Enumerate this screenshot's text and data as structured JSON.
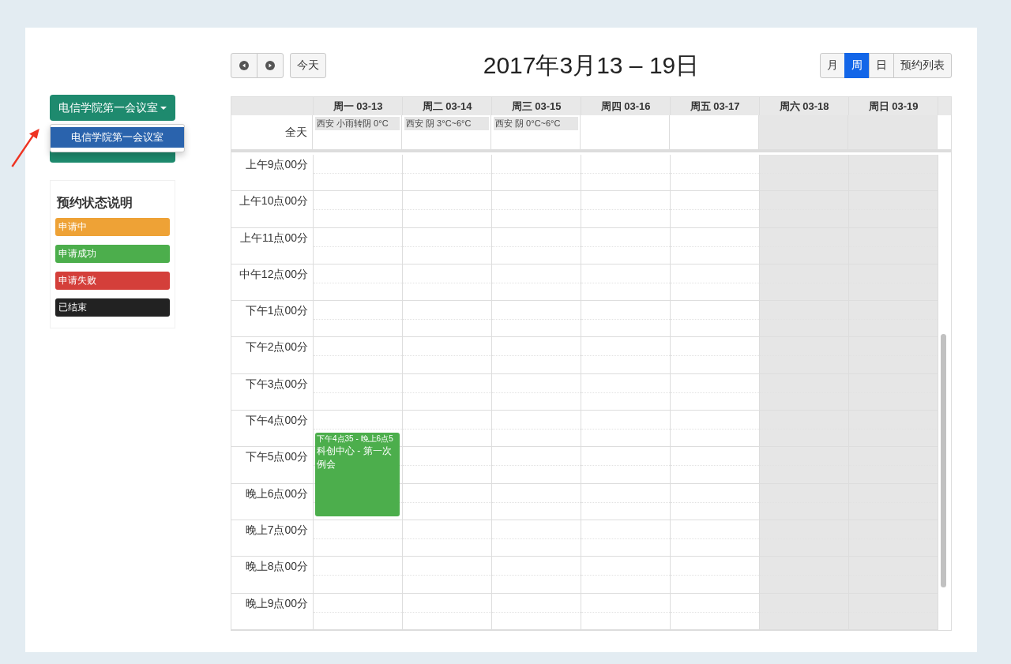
{
  "sidebar": {
    "room_dropdown": {
      "label": "电信学院第一会议室",
      "expanded": true,
      "options": [
        {
          "label": "电信学院第一会议室",
          "selected": true
        }
      ]
    },
    "legend": {
      "title": "预约状态说明",
      "items": [
        {
          "label": "申请中",
          "color": "#eea236"
        },
        {
          "label": "申请成功",
          "color": "#4cae4c"
        },
        {
          "label": "申请失败",
          "color": "#d43f3a"
        },
        {
          "label": "已结束",
          "color": "#222222"
        }
      ]
    }
  },
  "toolbar": {
    "today_button": "今天",
    "title": "2017年3月13 – 19日",
    "views": [
      {
        "label": "月",
        "selected": false
      },
      {
        "label": "周",
        "selected": true
      },
      {
        "label": "日",
        "selected": false
      },
      {
        "label": "预约列表",
        "selected": false
      }
    ]
  },
  "calendar": {
    "allday_label": "全天",
    "days": [
      {
        "header": "周一 03-13",
        "weekend": false,
        "weather": "西安 小雨转阴 0°C",
        "events": [
          {
            "time": "下午4点35 - 晚上6点5",
            "title": "科创中心 - 第一次例会",
            "color": "#4cae4c"
          }
        ]
      },
      {
        "header": "周二 03-14",
        "weekend": false,
        "weather": "西安 阴 3°C~6°C"
      },
      {
        "header": "周三 03-15",
        "weekend": false,
        "weather": "西安 阴 0°C~6°C"
      },
      {
        "header": "周四 03-16",
        "weekend": false
      },
      {
        "header": "周五 03-17",
        "weekend": false
      },
      {
        "header": "周六 03-18",
        "weekend": true
      },
      {
        "header": "周日 03-19",
        "weekend": true
      }
    ],
    "times": [
      "上午9点00分",
      "上午10点00分",
      "上午11点00分",
      "中午12点00分",
      "下午1点00分",
      "下午2点00分",
      "下午3点00分",
      "下午4点00分",
      "下午5点00分",
      "晚上6点00分",
      "晚上7点00分",
      "晚上8点00分",
      "晚上9点00分"
    ]
  }
}
